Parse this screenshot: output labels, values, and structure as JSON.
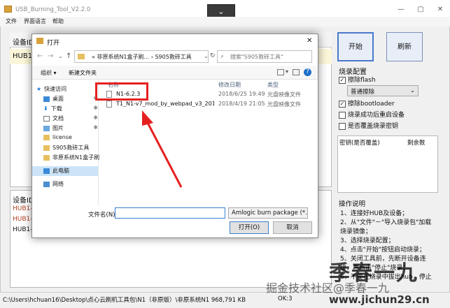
{
  "app": {
    "title": "USB_Burning_Tool_V2.2.0",
    "menu": [
      "文件",
      "界面语言",
      "帮助"
    ]
  },
  "left": {
    "devices_label": "设备ID",
    "hub_item": "HUB1",
    "bottom_header": "设备ID",
    "bottom_rows": [
      "HUB1-",
      "HUB1-",
      "HUB1-"
    ]
  },
  "right": {
    "start": "开始",
    "refresh": "刷新",
    "config_title": "烧录配置",
    "erase_flash": "擦除flash",
    "erase_mode": "普通擦除",
    "erase_bootloader": "擦除bootloader",
    "reboot_after": "烧录成功后重启设备",
    "overwrite_key": "是否覆盖烧录密钥",
    "key_col1": "密钥(是否覆盖)",
    "key_col2": "剩余数",
    "op_title": "操作说明",
    "op_lines": [
      "1、连接好HUB及设备；",
      "2、从\"文件\"－\"导入烧录包\"加载",
      "烧录镜像；",
      "3、选择烧录配置；",
      "4、点击\"开始\"按钮启动烧录；",
      "5、关闭工具前，先断开设备连",
      "接，再点击\"停止\"烧录；",
      "6、不要在烧录中拔出hub，停止"
    ]
  },
  "status": {
    "path": "C:\\Users\\hchuan16\\Desktop\\点心云刷机工具包\\N1（非原版）\\非原系统N1 968,791 KB",
    "ok_label": "OK:3"
  },
  "dialog": {
    "title": "打开",
    "breadcrumb": [
      "«",
      "非原系统N1盒子刷...",
      "›",
      "S905救砖工具"
    ],
    "search_placeholder": "搜索\"S905救砖工具\"",
    "organize": "组织 ▾",
    "new_folder": "新建文件夹",
    "sidebar": [
      {
        "label": "快速访问",
        "icon": "star"
      },
      {
        "label": "桌面",
        "icon": "desktop"
      },
      {
        "label": "下载",
        "icon": "download"
      },
      {
        "label": "文档",
        "icon": "document"
      },
      {
        "label": "图片",
        "icon": "picture"
      },
      {
        "label": "license",
        "icon": "folder"
      },
      {
        "label": "S905救砖工具",
        "icon": "folder"
      },
      {
        "label": "非原系统N1盒子刷",
        "icon": "folder"
      },
      {
        "label": "此电脑",
        "icon": "computer"
      },
      {
        "label": "网络",
        "icon": "network"
      }
    ],
    "columns": [
      "名称",
      "修改日期",
      "类型"
    ],
    "files": [
      {
        "name": "N1-6.2.3",
        "date": "2018/6/25 19:49",
        "type": "光盘映像文件"
      },
      {
        "name": "T1_N1-v7_mod_by_webpad_v3_2018...",
        "date": "2018/4/19 21:05",
        "type": "光盘映像文件"
      }
    ],
    "filename_label": "文件名(N):",
    "filetype": "Amlogic burn package (*.img",
    "open": "打开(O)",
    "cancel": "取消"
  },
  "watermark": {
    "line1": "季春一九",
    "line2": "掘金技术社区@季春一九",
    "line3": "www.jichun29.cn"
  }
}
